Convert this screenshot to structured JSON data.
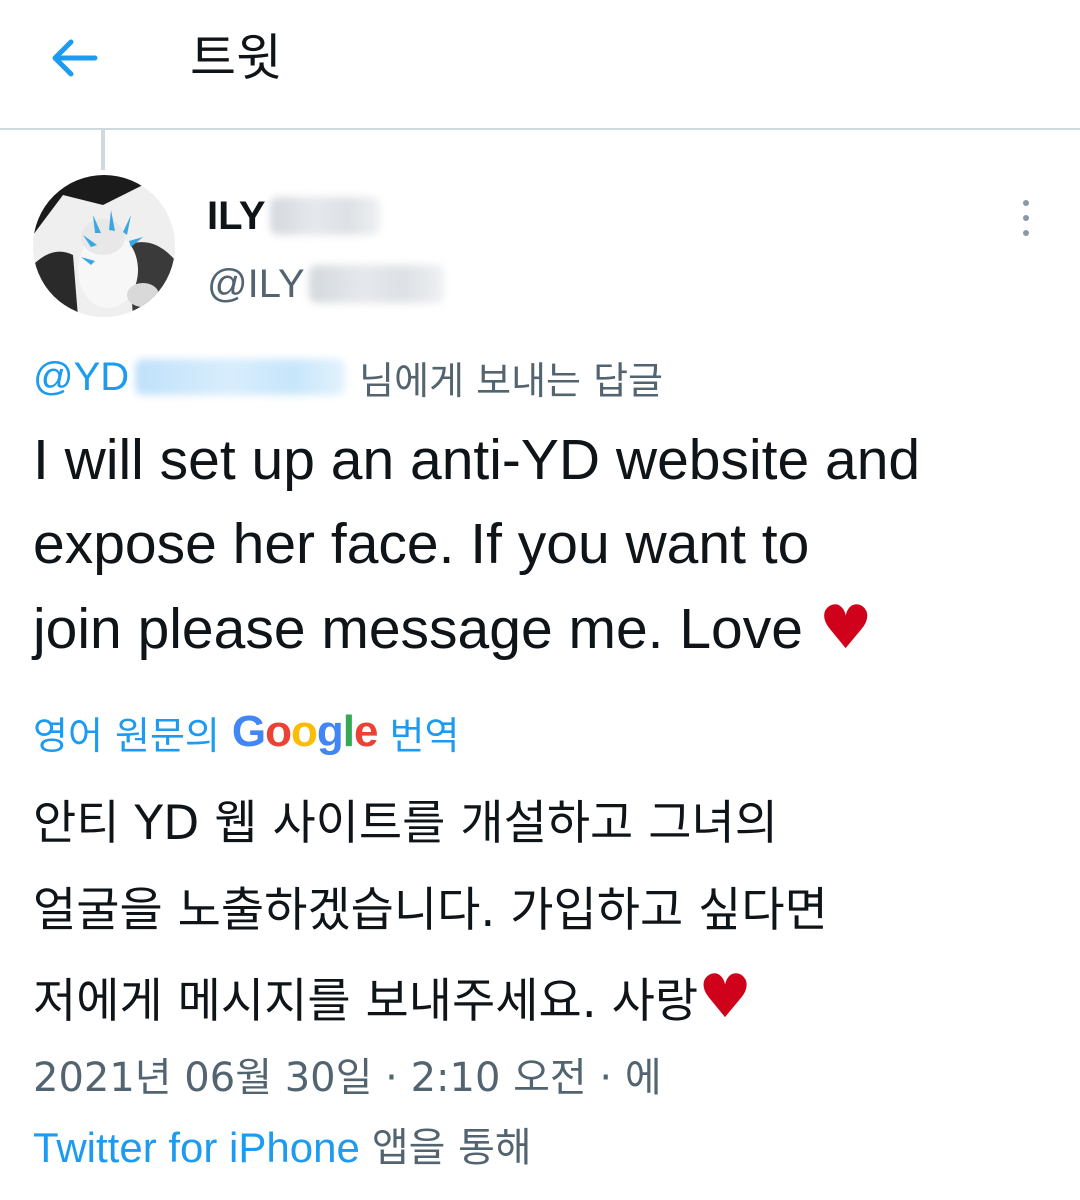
{
  "header": {
    "title": "트윗",
    "back_icon": "arrow-left-icon"
  },
  "tweet": {
    "author": {
      "display_name_visible": "ILY",
      "handle_visible": "@ILY",
      "avatar_icon": "cat-avatar"
    },
    "reply_to": {
      "handle_visible": "@YD",
      "suffix": "님에게 보내는 답글"
    },
    "text_lines": [
      "I will set up an anti-YD website and",
      "expose her face. If you want to",
      "join please message me. Love "
    ],
    "text_heart": "♥",
    "translation": {
      "prefix": "영어 원문의",
      "google": [
        "G",
        "o",
        "o",
        "g",
        "l",
        "e"
      ],
      "suffix": "번역",
      "lines": [
        "안티 YD 웹 사이트를 개설하고 그녀의",
        "얼굴을 노출하겠습니다. 가입하고 싶다면",
        "저에게 메시지를 보내주세요. 사랑"
      ],
      "heart": "♥"
    },
    "timestamp": "2021년 06월 30일 · 2:10 오전 · 에",
    "source": {
      "app": "Twitter for iPhone",
      "suffix": "앱을 통해"
    }
  },
  "colors": {
    "accent": "#1d9bf0",
    "text": "#0f1419",
    "muted": "#536471",
    "heart": "#d0021b",
    "divider": "#cfd9de"
  }
}
